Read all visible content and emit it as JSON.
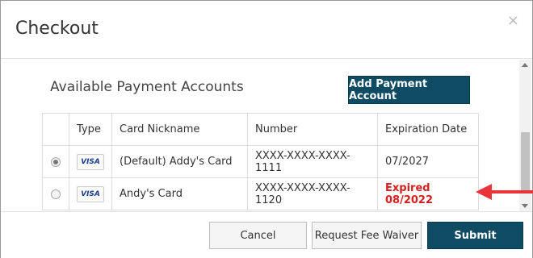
{
  "dialog": {
    "title": "Checkout",
    "close_glyph": "×"
  },
  "section": {
    "title": "Available Payment Accounts",
    "add_button": "Add Payment Account"
  },
  "table": {
    "headers": [
      "",
      "Type",
      "Card Nickname",
      "Number",
      "Expiration Date"
    ],
    "rows": [
      {
        "selected": true,
        "type": "VISA",
        "nickname": "(Default) Addy's Card",
        "number": "XXXX-XXXX-XXXX-1111",
        "expiration": "07/2027",
        "expired": false
      },
      {
        "selected": false,
        "type": "VISA",
        "nickname": "Andy's Card",
        "number": "XXXX-XXXX-XXXX-1120",
        "expiration": "Expired 08/2022",
        "expired": true
      }
    ]
  },
  "footer": {
    "cancel": "Cancel",
    "fee_waiver": "Request Fee Waiver",
    "submit": "Submit"
  },
  "colors": {
    "primary": "#0f4c64",
    "expired": "#d42020",
    "annotation_arrow": "#e8343a"
  },
  "icons": {
    "close": "close-icon",
    "card_brand": "visa-card-icon",
    "annotation": "red-arrow-icon"
  }
}
